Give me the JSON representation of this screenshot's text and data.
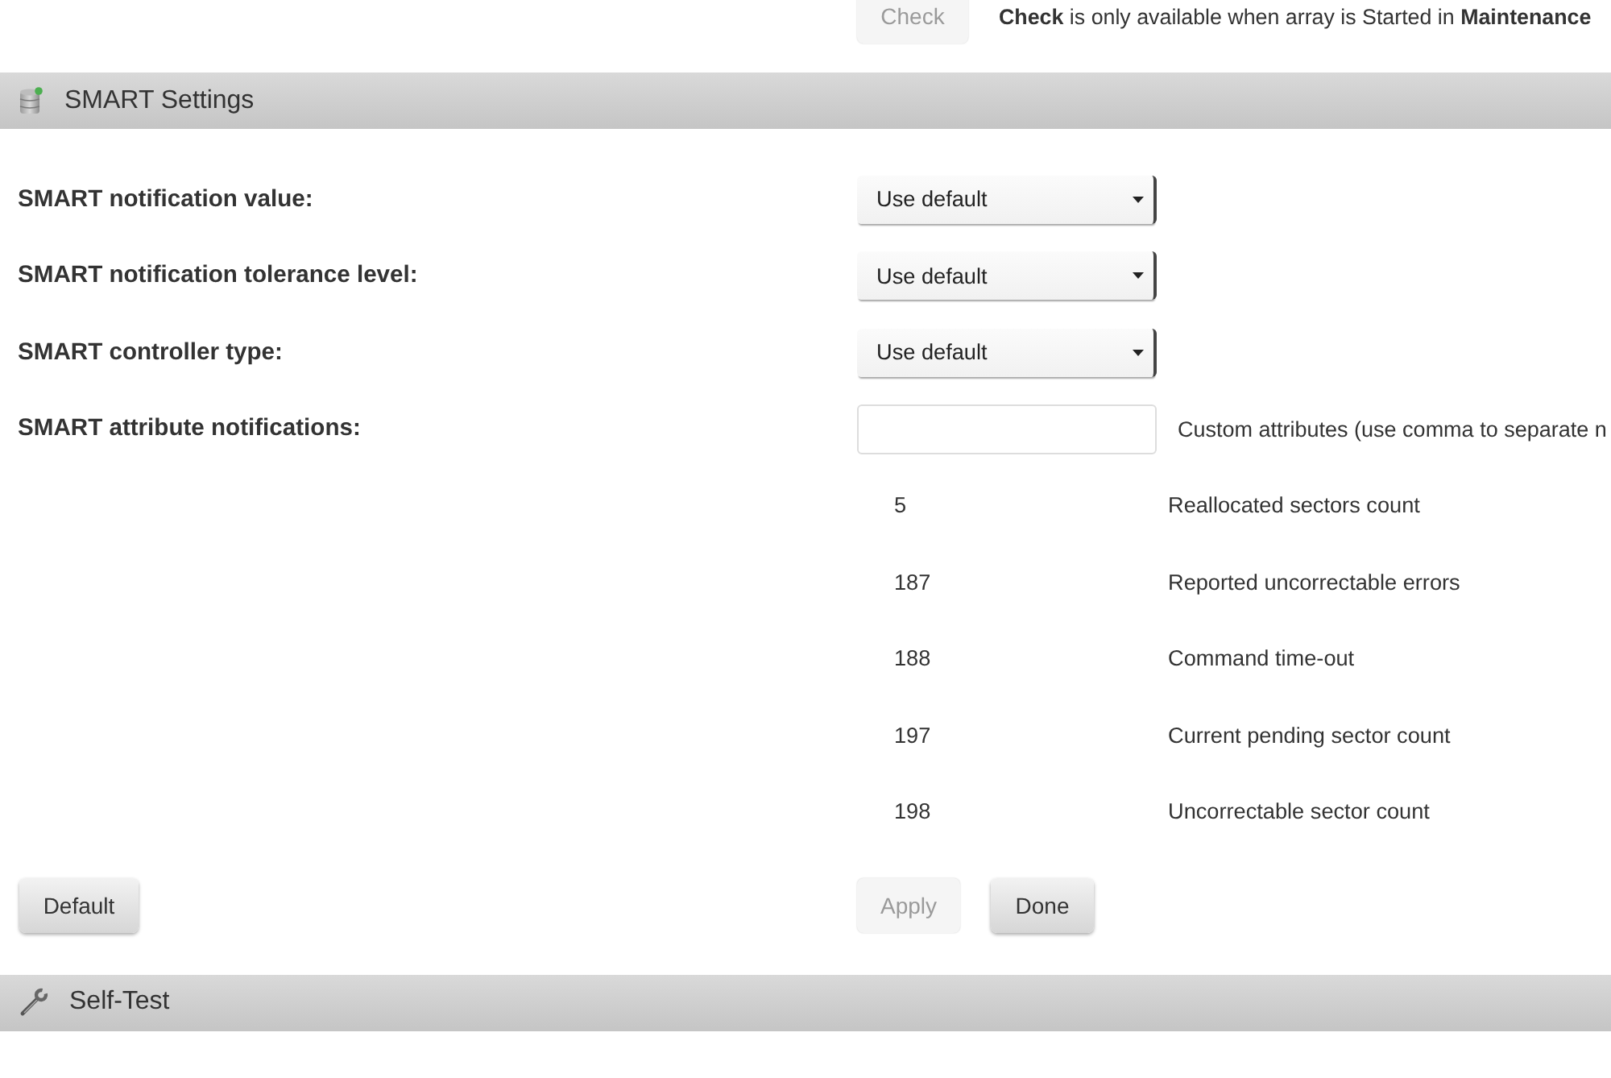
{
  "notice": {
    "button": {
      "label": "Check",
      "disabled": true
    },
    "text": "**Check** is only available when array is Started in **Maintenance**"
  },
  "smart_settings": {
    "title": "SMART Settings",
    "fields": [
      {
        "kind": "select",
        "label": "SMART notification value:",
        "value": "Use default"
      },
      {
        "kind": "select",
        "label": "SMART notification tolerance level:",
        "value": "Use default"
      },
      {
        "kind": "select",
        "label": "SMART controller type:",
        "value": "Use default"
      },
      {
        "kind": "input",
        "label": "SMART attribute notifications:",
        "note": "Custom attributes (use comma to separate n"
      }
    ],
    "attributes": [
      {
        "number": "5",
        "name": "Reallocated sectors count"
      },
      {
        "number": "187",
        "name": "Reported uncorrectable errors"
      },
      {
        "number": "188",
        "name": "Command time-out"
      },
      {
        "number": "197",
        "name": "Current pending sector count"
      },
      {
        "number": "198",
        "name": "Uncorrectable sector count"
      }
    ],
    "left_buttons": [
      {
        "label": "Default",
        "disabled": false
      }
    ],
    "right_buttons": [
      {
        "label": "Apply",
        "disabled": true
      },
      {
        "label": "Done",
        "disabled": false
      }
    ]
  },
  "self_test": {
    "title": "Self-Test"
  }
}
